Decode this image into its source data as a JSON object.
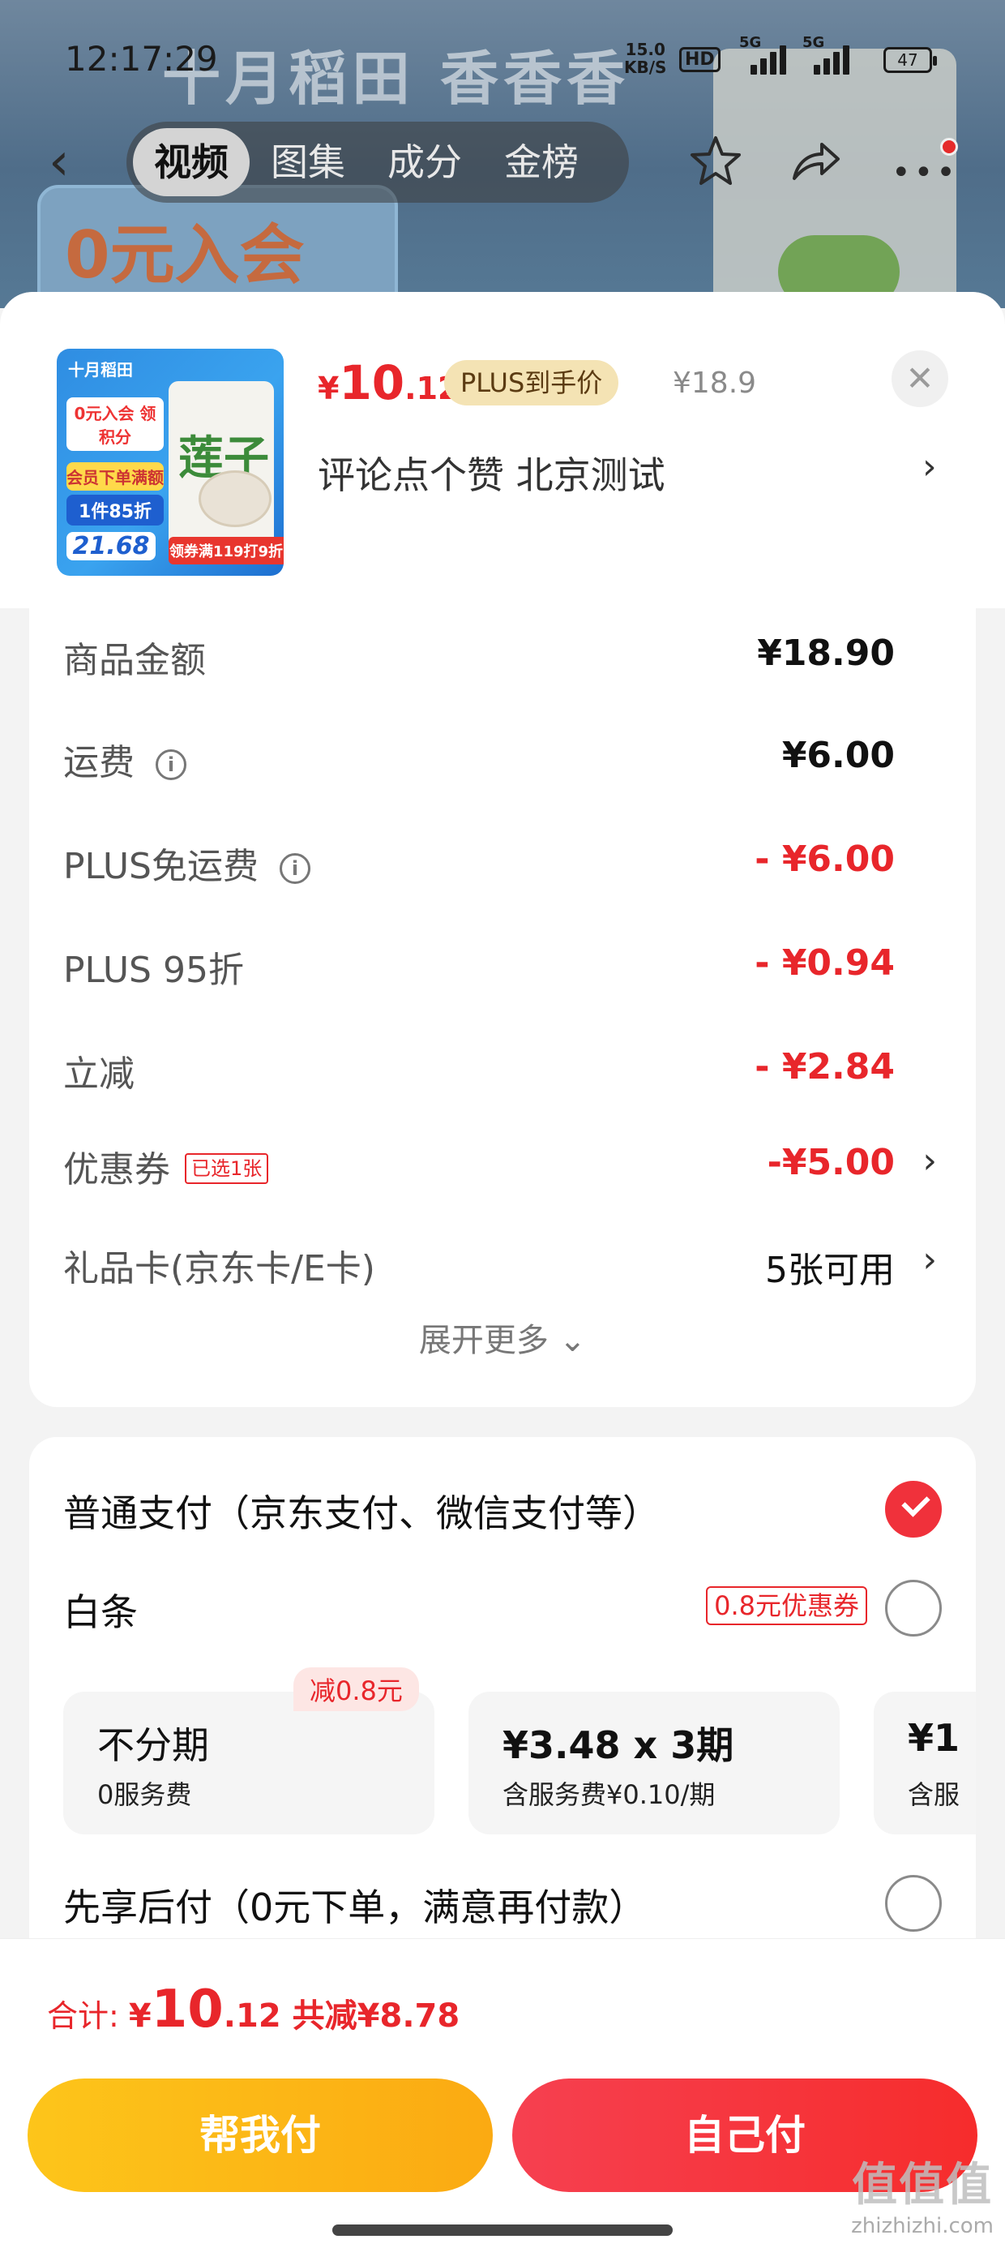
{
  "status_bar": {
    "time": "12:17:29",
    "net_speed": "15.0",
    "net_unit": "KB/S",
    "hd": "HD",
    "signal1": "5G",
    "signal2": "5G",
    "battery": "47"
  },
  "background": {
    "brand": "十月稻田 香香香",
    "promo": "0元入会"
  },
  "nav": {
    "tabs": [
      "视频",
      "图集",
      "成分",
      "金榜"
    ],
    "active_tab": "视频",
    "icons": [
      "back-arrow",
      "star",
      "share",
      "more"
    ]
  },
  "product": {
    "price_symbol": "¥",
    "price_int": "10",
    "price_dec": ".12",
    "plus_label": "PLUS到手价",
    "original_price": "¥18.9",
    "spec": "评论点个赞  北京测试",
    "thumbnail": {
      "brand": "十月稻田",
      "lotus": "莲子",
      "tag1": "0元入会 领积分",
      "tag2": "会员下单满额",
      "tag3": "1件85折",
      "price": "21.68",
      "ribbon": "领券满119打9折"
    }
  },
  "price_rows": [
    {
      "label": "商品金额",
      "value": "¥18.90"
    },
    {
      "label": "运费",
      "value": "¥6.00"
    },
    {
      "label": "PLUS免运费",
      "value": "- ¥6.00"
    },
    {
      "label": "PLUS 95折",
      "value": "- ¥0.94"
    },
    {
      "label": "立减",
      "value": "- ¥2.84"
    },
    {
      "label": "优惠券",
      "tag": "已选1张",
      "value": "-¥5.00"
    },
    {
      "label": "礼品卡(京东卡/E卡)",
      "value": "5张可用"
    }
  ],
  "expand_more": "展开更多 ⌄",
  "payment": {
    "normal": "普通支付（京东支付、微信支付等）",
    "baitiao": "白条",
    "baitiao_coupon": "0.8元优惠券",
    "plans": [
      {
        "title": "不分期",
        "sub": "0服务费",
        "discount": "减0.8元"
      },
      {
        "title": "¥3.48 x 3期",
        "sub": "含服务费¥0.10/期"
      },
      {
        "title": "¥1",
        "sub": "含服"
      }
    ],
    "pay_later": "先享后付（0元下单，满意再付款）"
  },
  "bottom": {
    "total_label": "合计: ",
    "total_symbol": "¥",
    "total_int": "10",
    "total_dec": ".12",
    "total_saved": "共减¥8.78",
    "help_pay": "帮我付",
    "self_pay": "自己付"
  },
  "watermark": {
    "logo": "值值值",
    "site": "zhizhizhi.com"
  },
  "colors": {
    "accent_red": "#e8262b",
    "plus_gold": "#f4e3b4",
    "help_btn": "#fbaa12",
    "self_btn": "#f62c2c"
  }
}
